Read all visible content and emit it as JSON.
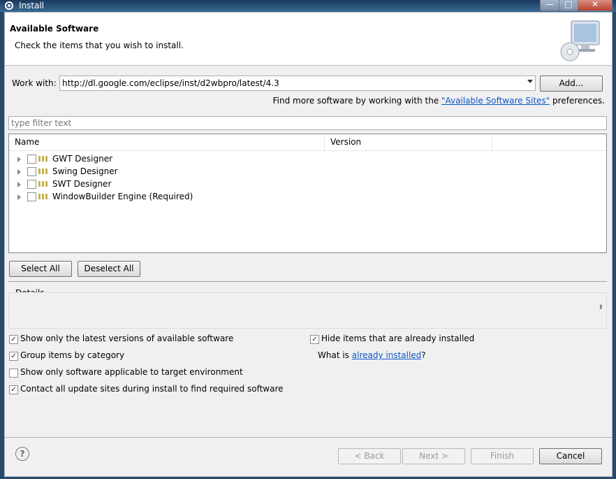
{
  "window": {
    "title": "Install",
    "minimize": "—",
    "maximize": "□",
    "close": "✕"
  },
  "header": {
    "title": "Available Software",
    "description": "Check the items that you wish to install.",
    "banner_icon": "install-banner-icon"
  },
  "work_with": {
    "label": "Work with:",
    "value": "http://dl.google.com/eclipse/inst/d2wbpro/latest/4.3",
    "add_label": "Add..."
  },
  "find_more": {
    "prefix": "Find more software by working with the ",
    "link": "\"Available Software Sites\"",
    "suffix": " preferences."
  },
  "filter": {
    "placeholder": "type filter text"
  },
  "tree": {
    "columns": [
      "Name",
      "Version",
      ""
    ],
    "items": [
      {
        "label": "GWT Designer"
      },
      {
        "label": "Swing Designer"
      },
      {
        "label": "SWT Designer"
      },
      {
        "label": "WindowBuilder Engine (Required)"
      }
    ]
  },
  "buttons": {
    "select_all": "Select All",
    "deselect_all": "Deselect All"
  },
  "details": {
    "label": "Details"
  },
  "options": {
    "latest_versions": "Show only the latest versions of available software",
    "group_by_category": "Group items by category",
    "target_env": "Show only software applicable to target environment",
    "contact_sites": "Contact all update sites during install to find required software",
    "hide_installed": "Hide items that are already installed",
    "what_is_prefix": "What is ",
    "what_is_link": "already installed",
    "what_is_suffix": "?"
  },
  "footer": {
    "help": "?",
    "back": "< Back",
    "next": "Next >",
    "finish": "Finish",
    "cancel": "Cancel"
  }
}
